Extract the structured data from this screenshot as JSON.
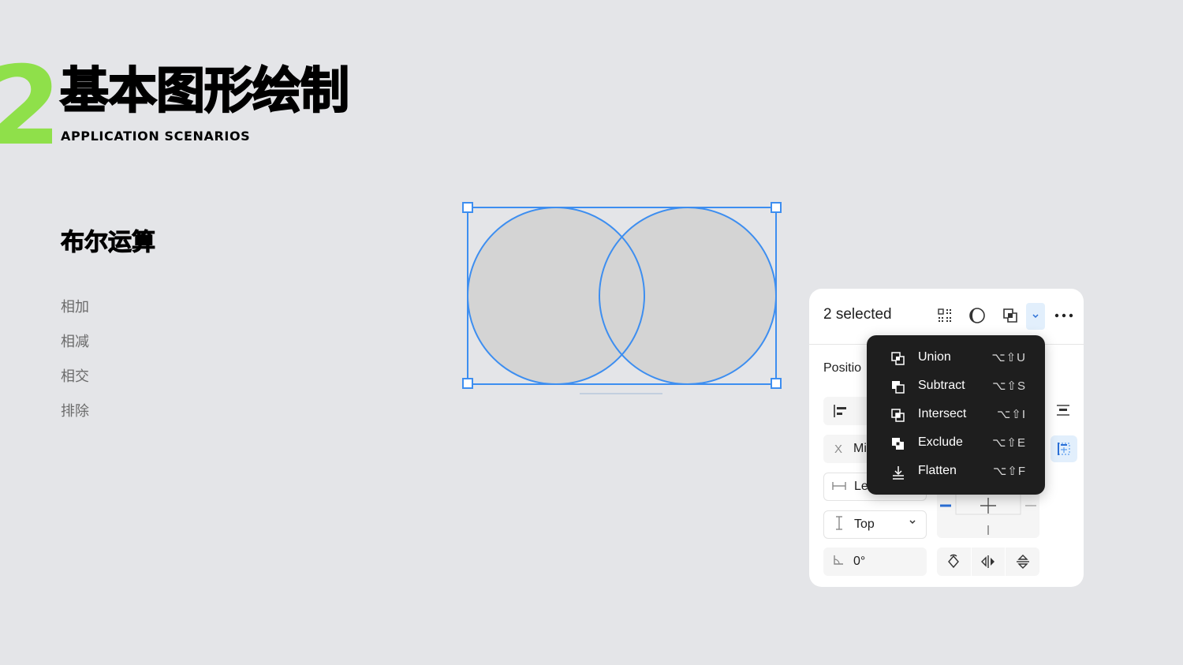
{
  "slide": {
    "number": "2",
    "title": "基本图形绘制",
    "subtitle": "APPLICATION SCENARIOS",
    "section_title": "布尔运算",
    "operations": [
      "相加",
      "相减",
      "相交",
      "排除"
    ]
  },
  "panel": {
    "selected_label": "2 selected",
    "position_label": "Positio",
    "x_prefix": "X",
    "x_value": "Mi",
    "h_value": "Le",
    "v_value": "Top",
    "rotation_value": "0°"
  },
  "boolean_menu": {
    "items": [
      {
        "label": "Union",
        "shortcut": "⌥⇧U",
        "icon": "union-icon"
      },
      {
        "label": "Subtract",
        "shortcut": "⌥⇧S",
        "icon": "subtract-icon"
      },
      {
        "label": "Intersect",
        "shortcut": "⌥⇧I",
        "icon": "intersect-icon"
      },
      {
        "label": "Exclude",
        "shortcut": "⌥⇧E",
        "icon": "exclude-icon"
      },
      {
        "label": "Flatten",
        "shortcut": "⌥⇧F",
        "icon": "flatten-icon"
      }
    ]
  },
  "colors": {
    "background": "#e4e5e8",
    "accent_green": "#8fe04a",
    "selection_blue": "#3d8ef0",
    "shape_fill": "#d4d4d4",
    "menu_bg": "#1e1e1e"
  }
}
